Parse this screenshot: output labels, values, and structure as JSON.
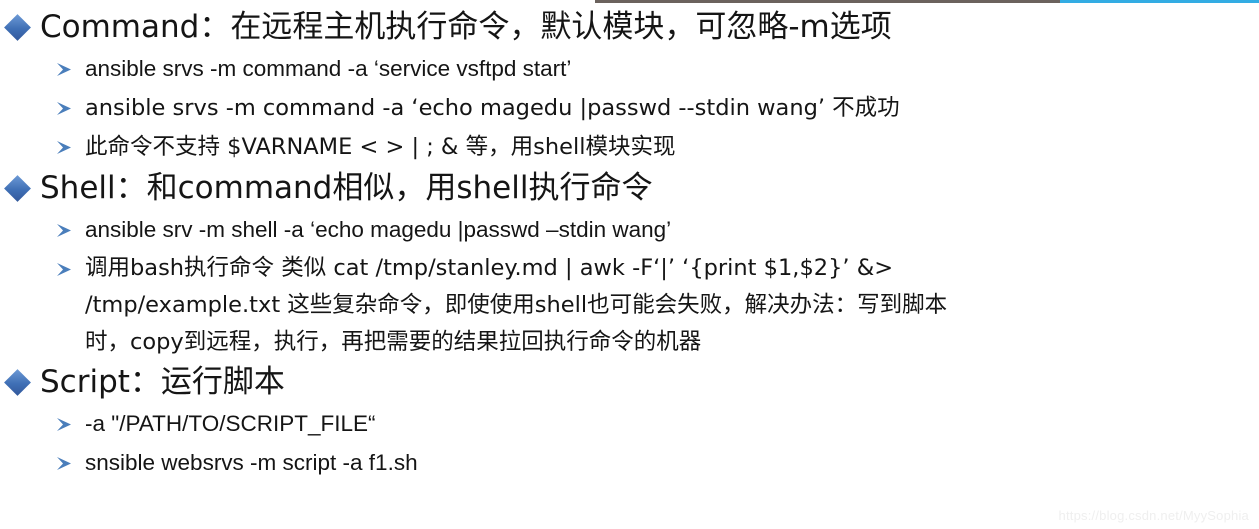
{
  "slide": {
    "top_rules": {
      "dark_color": "#6b625d",
      "blue_color": "#33ace3"
    },
    "bullets": [
      {
        "icon": "diamond-bullet-icon",
        "title": "Command：在远程主机执行命令，默认模块，可忽略-m选项",
        "children": [
          {
            "icon": "arrow-bullet-icon",
            "text": "ansible srvs -m command -a ‘service vsftpd start’"
          },
          {
            "icon": "arrow-bullet-icon",
            "text": "ansible srvs -m command -a ‘echo magedu |passwd --stdin wang’  不成功"
          },
          {
            "icon": "arrow-bullet-icon",
            "text": "此命令不支持 $VARNAME < > | ; & 等，用shell模块实现"
          }
        ]
      },
      {
        "icon": "diamond-bullet-icon",
        "title": "Shell：和command相似，用shell执行命令",
        "children": [
          {
            "icon": "arrow-bullet-icon",
            "text": "ansible srv -m shell -a ‘echo magedu |passwd –stdin wang’"
          },
          {
            "icon": "arrow-bullet-icon",
            "lines": [
              "调用bash执行命令 类似 cat /tmp/stanley.md | awk -F‘|’ ‘{print $1,$2}’ &>",
              "/tmp/example.txt 这些复杂命令，即使使用shell也可能会失败，解决办法：写到脚本",
              "时，copy到远程，执行，再把需要的结果拉回执行命令的机器"
            ]
          }
        ]
      },
      {
        "icon": "diamond-bullet-icon",
        "title": "Script：运行脚本",
        "children": [
          {
            "icon": "arrow-bullet-icon",
            "text": "-a \"/PATH/TO/SCRIPT_FILE“"
          },
          {
            "icon": "arrow-bullet-icon",
            "text": "snsible websrvs  -m script -a f1.sh"
          }
        ]
      }
    ],
    "watermark": "https://blog.csdn.net/MyySophia"
  }
}
